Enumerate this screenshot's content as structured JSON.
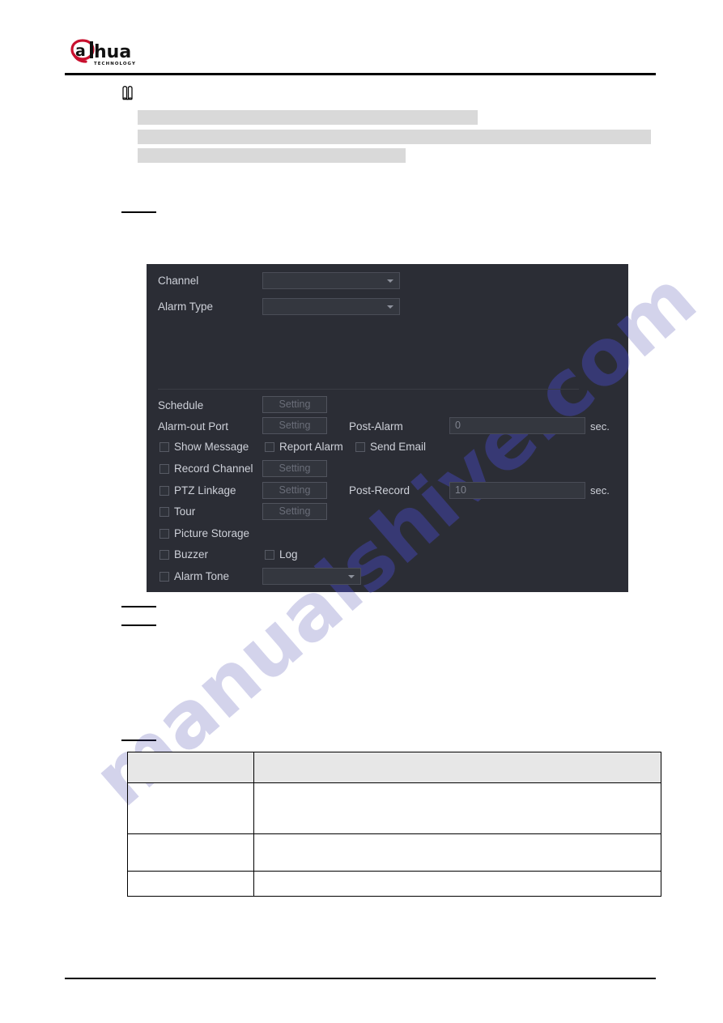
{
  "document": {
    "brand": {
      "name": "alhua",
      "wordmark": "dahua",
      "tagline": "TECHNOLOGY"
    },
    "watermark": "manualshive.com",
    "note_icon_name": "note-book-icon",
    "redacted_blocks": [
      "",
      "",
      ""
    ],
    "rule_marks": [
      "",
      "",
      "",
      ""
    ]
  },
  "dialog": {
    "title": "",
    "fields": {
      "channel_label": "Channel",
      "channel_value": "",
      "alarm_type_label": "Alarm Type",
      "alarm_type_value": "",
      "schedule_label": "Schedule",
      "schedule_button": "Setting",
      "alarm_out_port_label": "Alarm-out Port",
      "alarm_out_port_button": "Setting",
      "post_alarm_label": "Post-Alarm",
      "post_alarm_value": "0",
      "post_alarm_unit": "sec.",
      "show_message_label": "Show Message",
      "report_alarm_label": "Report Alarm",
      "send_email_label": "Send Email",
      "record_channel_label": "Record Channel",
      "record_channel_button": "Setting",
      "ptz_linkage_label": "PTZ Linkage",
      "ptz_linkage_button": "Setting",
      "post_record_label": "Post-Record",
      "post_record_value": "10",
      "post_record_unit": "sec.",
      "tour_label": "Tour",
      "tour_button": "Setting",
      "picture_storage_label": "Picture Storage",
      "buzzer_label": "Buzzer",
      "log_label": "Log",
      "alarm_tone_label": "Alarm Tone",
      "alarm_tone_value": ""
    },
    "colors": {
      "background": "#2b2d35",
      "field_background": "#34373f",
      "text": "#ced1d9",
      "muted_text": "#6a6e79",
      "border": "#4a4d57"
    }
  },
  "table": {
    "headers": [
      "",
      ""
    ],
    "rows": [
      [
        "",
        ""
      ],
      [
        "",
        ""
      ],
      [
        "",
        ""
      ]
    ]
  }
}
